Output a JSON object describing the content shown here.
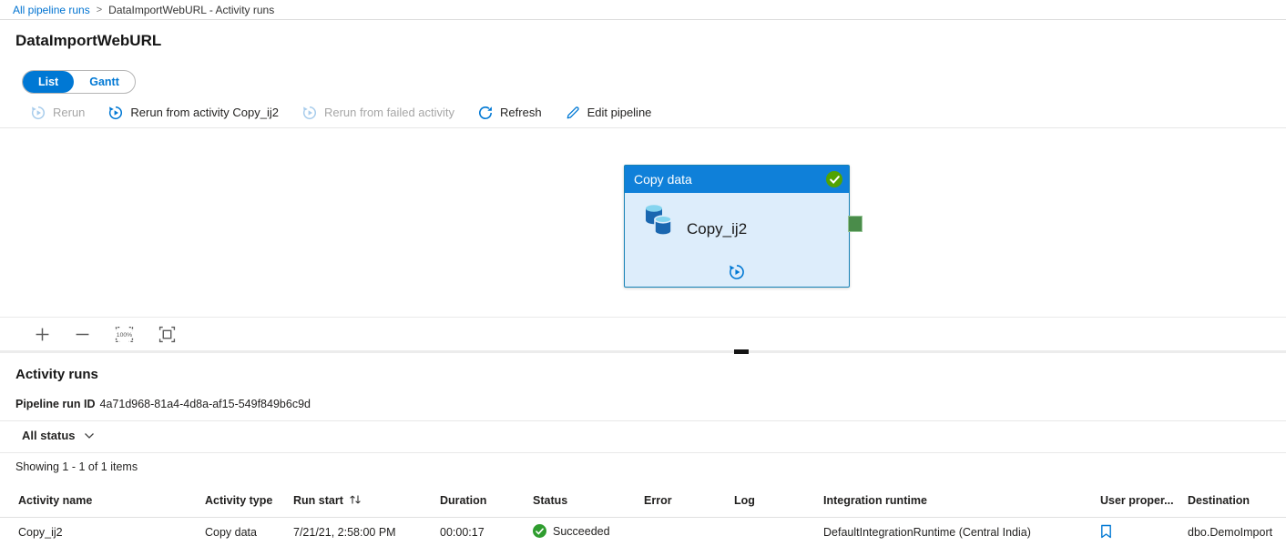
{
  "colors": {
    "accent": "#0078d4",
    "node_header_blue": "#0f80d9",
    "node_body_blue": "#ddedfb",
    "node_border_blue": "#1581b5",
    "success_green_badge": "#52a302",
    "success_green_table": "#2f9d2f",
    "port_green": "#4a8c4a"
  },
  "breadcrumb": {
    "link": "All pipeline runs",
    "separator": ">",
    "current": "DataImportWebURL - Activity runs"
  },
  "page": {
    "title": "DataImportWebURL"
  },
  "view_toggle": {
    "list_label": "List",
    "gantt_label": "Gantt"
  },
  "toolbar": {
    "rerun_label": "Rerun",
    "rerun_from_activity_label": "Rerun from activity Copy_ij2",
    "rerun_from_failed_label": "Rerun from failed activity",
    "refresh_label": "Refresh",
    "edit_pipeline_label": "Edit pipeline"
  },
  "canvas": {
    "node": {
      "type_label": "Copy data",
      "name": "Copy_ij2",
      "status_icon": "check-icon"
    },
    "zoom_level": "100%"
  },
  "activity_runs": {
    "heading": "Activity runs",
    "run_id_label": "Pipeline run ID",
    "run_id": "4a71d968-81a4-4d8a-af15-549f849b6c9d",
    "status_filter_label": "All status",
    "showing_text": "Showing 1 - 1 of 1 items",
    "table": {
      "columns": [
        "Activity name",
        "Activity type",
        "Run start",
        "Duration",
        "Status",
        "Error",
        "Log",
        "Integration runtime",
        "User proper...",
        "Destination"
      ],
      "rows": [
        {
          "activity_name": "Copy_ij2",
          "activity_type": "Copy data",
          "run_start": "7/21/21, 2:58:00 PM",
          "duration": "00:00:17",
          "status": "Succeeded",
          "error": "",
          "log": "",
          "integration_runtime": "DefaultIntegrationRuntime (Central India)",
          "user_properties_icon": "bookmark-icon",
          "destination": "dbo.DemoImport"
        }
      ]
    }
  }
}
